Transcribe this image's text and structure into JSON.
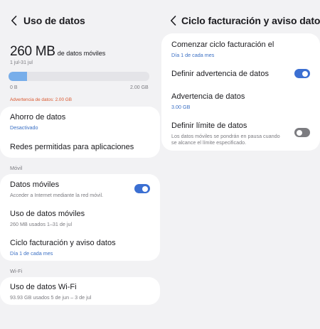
{
  "left": {
    "title": "Uso de datos",
    "summary": {
      "amount": "260 MB",
      "unit": "de datos móviles",
      "period": "1 jul-31 jul",
      "bar_fraction": 0.13,
      "bar_min": "0 B",
      "bar_max": "2.00 GB",
      "warning": "Advertencia de datos: 2.00 GB"
    },
    "group1": {
      "saver_title": "Ahorro de datos",
      "saver_status": "Desactivado",
      "apps_title": "Redes permitidas para aplicaciones"
    },
    "mobile_section": "Móvil",
    "mobile": {
      "data_title": "Datos móviles",
      "data_desc": "Acceder a Internet mediante la red móvil.",
      "data_on": true,
      "usage_title": "Uso de datos móviles",
      "usage_desc": "260 MB usados 1–31 de jul",
      "billing_title": "Ciclo facturación y aviso datos",
      "billing_desc": "Día 1 de cada mes"
    },
    "wifi_section": "Wi-Fi",
    "wifi": {
      "title": "Uso de datos Wi-Fi",
      "desc": "93.93 GB usados 5 de jun – 3 de jul"
    }
  },
  "right": {
    "title": "Ciclo facturación y aviso datos",
    "start_title": "Comenzar ciclo facturación el",
    "start_value": "Día 1 de cada mes",
    "warn_title": "Definir advertencia de datos",
    "warn_on": true,
    "warn_amount_title": "Advertencia de datos",
    "warn_amount_value": "3.00 GB",
    "limit_title": "Definir límite de datos",
    "limit_desc_1": "Los datos móviles se pondrán en pausa cuando",
    "limit_desc_2": "se alcance el límite especificado.",
    "limit_on": false
  },
  "colors": {
    "accent": "#3b6fd2",
    "link_blue": "#3a6fc4",
    "warning_orange": "#d9562c",
    "bar_fill": "#78aeea"
  }
}
